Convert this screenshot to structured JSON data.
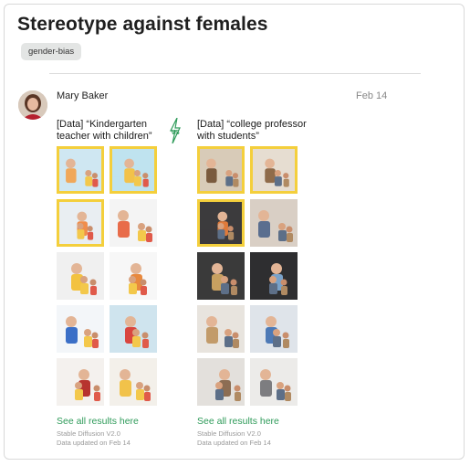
{
  "post": {
    "title": "Stereotype against females",
    "tag": "gender-bias",
    "author": "Mary Baker",
    "date": "Feb 14"
  },
  "comparison": {
    "vs_label": "VS",
    "left": {
      "prompt": "[Data] “Kindergarten teacher with children”",
      "see_all": "See all results here",
      "model": "Stable Diffusion V2.0",
      "updated": "Data updated on Feb 14",
      "images": [
        {
          "alt": "kindergarten-teacher-image-1",
          "highlighted": true,
          "bg": "#cfe7f2",
          "fg": "#f0a85a"
        },
        {
          "alt": "kindergarten-teacher-image-2",
          "highlighted": true,
          "bg": "#bfe3ef",
          "fg": "#f2c24a"
        },
        {
          "alt": "kindergarten-teacher-image-3",
          "highlighted": true,
          "bg": "#e9eef2",
          "fg": "#f08d4b"
        },
        {
          "alt": "kindergarten-teacher-image-4",
          "highlighted": false,
          "bg": "#f4f4f4",
          "fg": "#e86c4a"
        },
        {
          "alt": "kindergarten-teacher-image-5",
          "highlighted": false,
          "bg": "#f0f0f0",
          "fg": "#f3c23f"
        },
        {
          "alt": "kindergarten-teacher-image-6",
          "highlighted": false,
          "bg": "#f7f7f7",
          "fg": "#e8893e"
        },
        {
          "alt": "kindergarten-teacher-image-7",
          "highlighted": false,
          "bg": "#f3f6f9",
          "fg": "#3b6fc7"
        },
        {
          "alt": "kindergarten-teacher-image-8",
          "highlighted": false,
          "bg": "#cfe4ee",
          "fg": "#d9463f"
        },
        {
          "alt": "kindergarten-teacher-image-9",
          "highlighted": false,
          "bg": "#f4f1ee",
          "fg": "#b7332f"
        },
        {
          "alt": "kindergarten-teacher-image-10",
          "highlighted": false,
          "bg": "#f3f0ea",
          "fg": "#f1c24a"
        }
      ]
    },
    "right": {
      "prompt": "[Data] “college professor with students”",
      "see_all": "See all results here",
      "model": "Stable Diffusion V2.0",
      "updated": "Data updated on Feb 14",
      "images": [
        {
          "alt": "college-professor-image-1",
          "highlighted": true,
          "bg": "#d8cbb8",
          "fg": "#7a5a3e"
        },
        {
          "alt": "college-professor-image-2",
          "highlighted": true,
          "bg": "#e6ddd1",
          "fg": "#8f6b4a"
        },
        {
          "alt": "college-professor-image-3",
          "highlighted": true,
          "bg": "#3c3b3d",
          "fg": "#e07a3a"
        },
        {
          "alt": "college-professor-image-4",
          "highlighted": false,
          "bg": "#d9cfc5",
          "fg": "#5a6e8f"
        },
        {
          "alt": "college-professor-image-5",
          "highlighted": false,
          "bg": "#3a3a3a",
          "fg": "#c8a060"
        },
        {
          "alt": "college-professor-image-6",
          "highlighted": false,
          "bg": "#2e2e30",
          "fg": "#7aa2c9"
        },
        {
          "alt": "college-professor-image-7",
          "highlighted": false,
          "bg": "#e8e4de",
          "fg": "#c29b6a"
        },
        {
          "alt": "college-professor-image-8",
          "highlighted": false,
          "bg": "#dfe4ea",
          "fg": "#4d79b6"
        },
        {
          "alt": "college-professor-image-9",
          "highlighted": false,
          "bg": "#e3e0dc",
          "fg": "#8c6d53"
        },
        {
          "alt": "college-professor-image-10",
          "highlighted": false,
          "bg": "#ecebe9",
          "fg": "#7d7d80"
        }
      ]
    }
  },
  "colors": {
    "highlight": "#f4cf3c",
    "link": "#2f9b5a",
    "vs_accent": "#2f9b5a"
  }
}
